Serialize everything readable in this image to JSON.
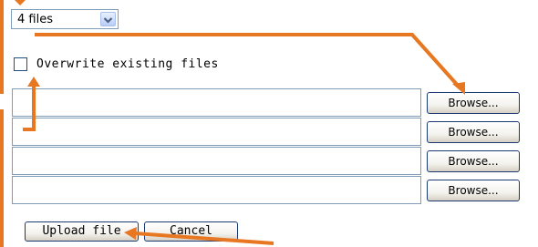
{
  "upload": {
    "file_count_selected": "4 files",
    "overwrite_label": "Overwrite existing files",
    "overwrite_checked": false,
    "browse_labels": [
      "Browse...",
      "Browse...",
      "Browse...",
      "Browse..."
    ],
    "upload_label": "Upload file",
    "cancel_label": "Cancel"
  },
  "colors": {
    "annotation": "#e87722",
    "field_border": "#7f9db9",
    "button_border": "#1c3a72"
  }
}
